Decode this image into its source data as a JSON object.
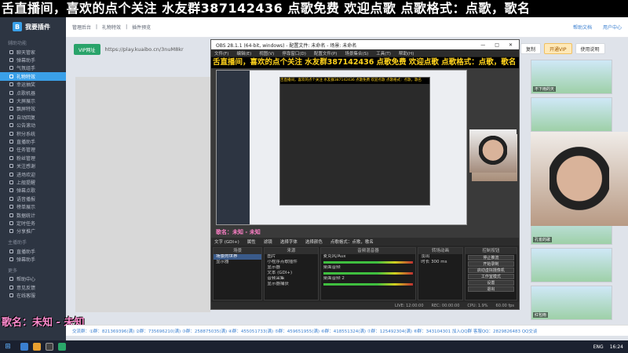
{
  "banner": {
    "text": "舌直播间，喜欢的点个关注 水友群387142436 点歌免费 欢迎点歌 点歌格式：点歌，歌名"
  },
  "sidebar": {
    "logo": "我要插件",
    "group1": "辅助功能",
    "items": [
      "聊天管家",
      "弹幕助手",
      "气氛组手",
      "礼物特效",
      "幸运抽奖",
      "点歌机器",
      "大屏展示",
      "飘屏特效",
      "自动回复",
      "公告滚动",
      "积分系统",
      "直播助手",
      "任务管理",
      "粉丝管理",
      "关注感谢",
      "进场欢迎",
      "上舰提醒",
      "弹幕点歌",
      "语音播报",
      "榜单展示",
      "数据统计",
      "定时任务",
      "分享推广"
    ],
    "group2": "主播助手",
    "items2": [
      "直播助手",
      "弹幕助手"
    ],
    "group3": "更多",
    "items3": [
      "帮助中心",
      "意见反馈",
      "在线客服"
    ],
    "active_index": 3
  },
  "topbar": {
    "breadcrumb": [
      "管理后台",
      "礼物特效",
      "插件预览"
    ],
    "right": [
      "帮助文档",
      "用户中心"
    ]
  },
  "urlbar": {
    "vip_label": "VIP网址",
    "url": "https://play.kuaibo.cn/3nuM8kr"
  },
  "toolbar_right": {
    "copy": "复制",
    "vip": "开通VIP",
    "help": "使用说明"
  },
  "obs": {
    "title": "OBS 28.1.1 (64-bit, windows) - 配置文件: 未命名 - 场景: 未命名",
    "menu": [
      "文件(F)",
      "编辑(E)",
      "视图(V)",
      "停靠窗口(D)",
      "配置文件(P)",
      "场景集合(S)",
      "工具(T)",
      "帮助(H)"
    ],
    "banner": "舌直播间，喜欢的点个关注 水友群387142436 点歌免费 欢迎点歌 点歌格式：点歌，歌名",
    "preview_name": "歌名：未知 - 未知",
    "bar": [
      "文字 (GDI+)",
      "属性",
      "滤镜",
      "选择字体",
      "选择颜色",
      "点歌格式：点歌，歌名"
    ],
    "docks": {
      "scenes_title": "场景",
      "scenes": [
        "场景的世界",
        "显示器"
      ],
      "sources_title": "来源",
      "sources": [
        "图片",
        "小程序点歌插件",
        "显示器",
        "文本 (GDI+)",
        "音频采集",
        "显示器捕获"
      ],
      "mixer_title": "音频混音器",
      "mixer": [
        "麦克风/Aux",
        "桌面音频",
        "桌面音频 2"
      ],
      "trans_title": "转场动画",
      "trans_name": "淡出",
      "trans_time_label": "时长",
      "trans_time": "300 ms",
      "controls_title": "控制按钮",
      "controls": [
        "停止推流",
        "开始录制",
        "启动虚拟摄像机",
        "工作室模式",
        "设置",
        "退出"
      ]
    },
    "status": [
      "LIVE: 12:00:00",
      "REC: 00:00:00",
      "CPU: 1.9%",
      "60.00 fps"
    ]
  },
  "right_panel": {
    "thumbs": [
      "不下雨的天",
      "",
      "",
      "",
      "孔雀的歌",
      "",
      "红包雨"
    ]
  },
  "name_overlay": "歌名：未知 - 未知",
  "bottom_strip": "交流群：①群：821369396(满) ②群：735696210(满) ③群：258875035(满) ④群：455051733(满) ⑤群：459651955(满) ⑥群：418551324(满) ⑦群：125492304(满) ⑧群：343104301 加入QQ群 客服QQ：2829826483 QQ交谈",
  "taskbar": {
    "tray": [
      "ENG",
      "16:24"
    ]
  }
}
